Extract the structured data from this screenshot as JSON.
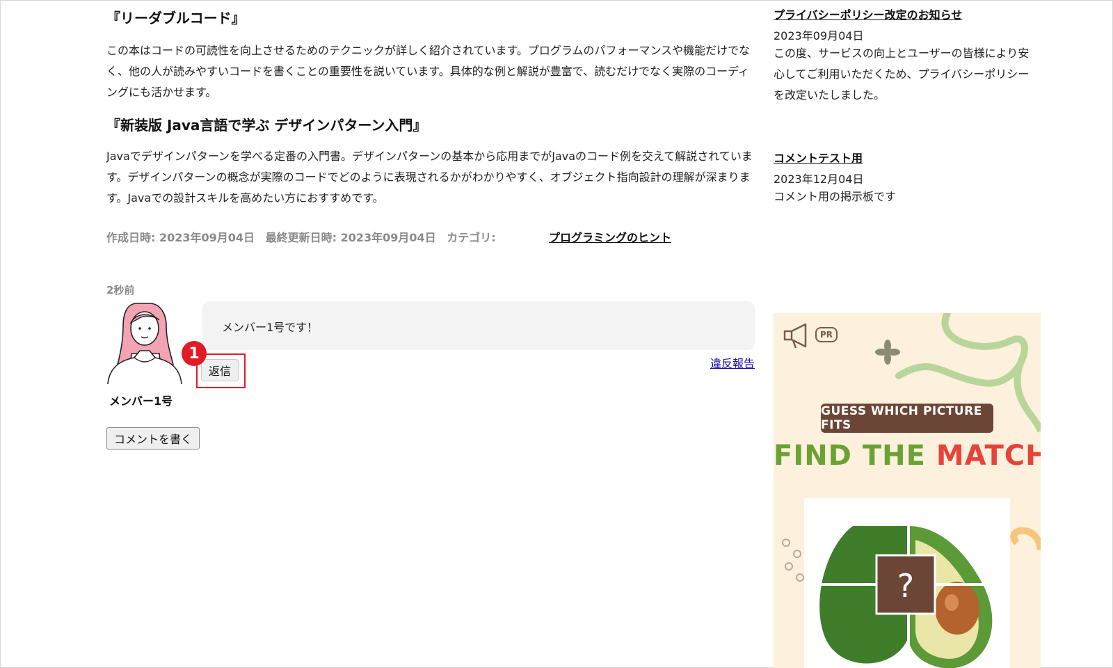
{
  "article": {
    "books": [
      {
        "title": "『リーダブルコード』",
        "description": "この本はコードの可読性を向上させるためのテクニックが詳しく紹介されています。プログラムのパフォーマンスや機能だけでなく、他の人が読みやすいコードを書くことの重要性を説いています。具体的な例と解説が豊富で、読むだけでなく実際のコーディングにも活かせます。"
      },
      {
        "title": "『新装版 Java言語で学ぶ デザインパターン入門』",
        "description": "Javaでデザインパターンを学べる定番の入門書。デザインパターンの基本から応用までがJavaのコード例を交えて解説されています。デザインパターンの概念が実際のコードでどのように表現されるかがわかりやすく、オブジェクト指向設計の理解が深まります。Javaでの設計スキルを高めたい方におすすめです。"
      }
    ],
    "meta": {
      "created": "作成日時: 2023年09月04日",
      "updated": "最終更新日時: 2023年09月04日",
      "category_label": "カテゴリ:",
      "category_link": "プログラミングのヒント"
    }
  },
  "comment": {
    "time": "2秒前",
    "author": "メンバー1号",
    "text": "メンバー1号です！",
    "reply_label": "返信",
    "report_label": "違反報告",
    "step_number": "1"
  },
  "write_comment_label": "コメントを書く",
  "sidebar": {
    "news": [
      {
        "title": "プライバシーポリシー改定のお知らせ",
        "date": "2023年09月04日",
        "body": "この度、サービスの向上とユーザーの皆様により安心してご利用いただくため、プライバシーポリシーを改定いたしました。"
      },
      {
        "title": "コメントテスト用",
        "date": "2023年12月04日",
        "body": "コメント用の掲示板です"
      }
    ],
    "ad": {
      "pr_label": "PR",
      "banner": "GUESS WHICH PICTURE FITS",
      "headline_part1": "FIND THE",
      "headline_part2": "MATCH",
      "question_mark": "?"
    }
  },
  "colors": {
    "highlight": "#e01b24",
    "link": "#1a0dab",
    "ad_background": "#fdf0dc",
    "ad_banner": "#6b4636",
    "ad_green": "#6aa236",
    "ad_red": "#e5433b"
  }
}
